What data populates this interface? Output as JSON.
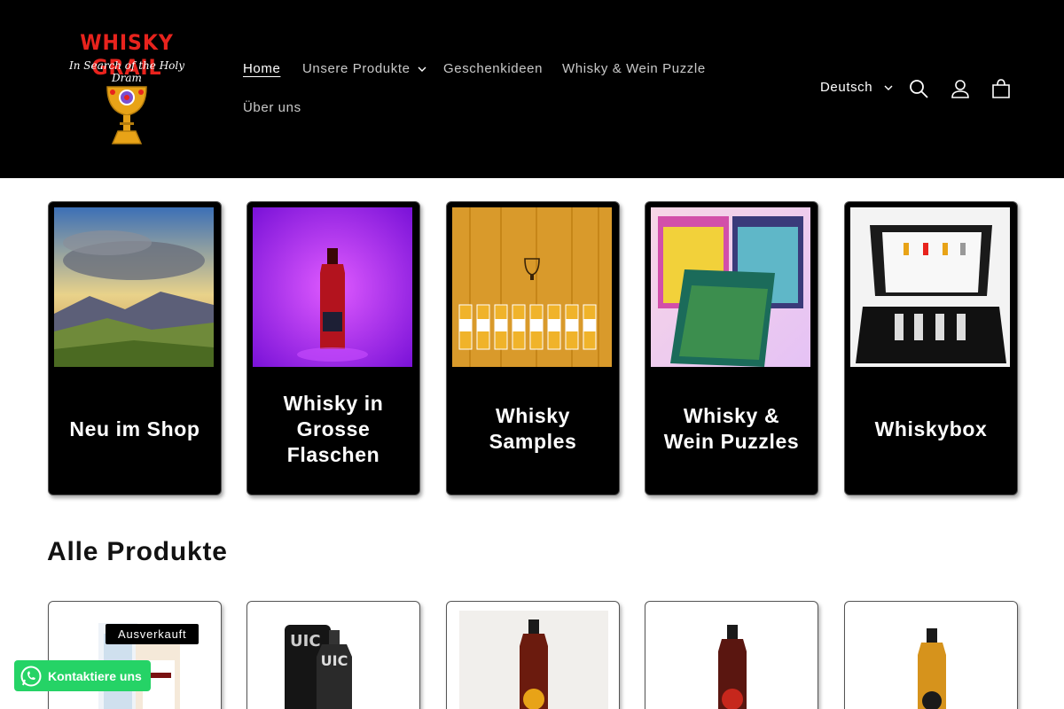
{
  "brand": {
    "name": "WHISKY GRAIL",
    "tagline": "In Search of the Holy Dram",
    "colors": {
      "logo_red": "#e8231d",
      "header_bg": "#000000",
      "whatsapp": "#25d366"
    }
  },
  "nav": {
    "items": [
      {
        "label": "Home",
        "active": true,
        "has_dropdown": false
      },
      {
        "label": "Unsere Produkte",
        "active": false,
        "has_dropdown": true
      },
      {
        "label": "Geschenkideen",
        "active": false,
        "has_dropdown": false
      },
      {
        "label": "Whisky & Wein Puzzle",
        "active": false,
        "has_dropdown": false
      },
      {
        "label": "Über uns",
        "active": false,
        "has_dropdown": false
      }
    ]
  },
  "header": {
    "language": "Deutsch",
    "icons": [
      "search-icon",
      "account-icon",
      "cart-icon"
    ]
  },
  "collections": [
    {
      "title": "Neu im Shop",
      "image": "mountain-sunrise"
    },
    {
      "title": "Whisky in Grosse Flaschen",
      "image": "bottle-purple"
    },
    {
      "title": "Whisky Samples",
      "image": "sample-bottles"
    },
    {
      "title": "Whisky & Wein Puzzles",
      "image": "puzzle-boxes"
    },
    {
      "title": "Whiskybox",
      "image": "gift-box"
    }
  ],
  "products_section": {
    "title": "Alle Produkte",
    "badge": "Ausverkauft"
  },
  "whatsapp": {
    "label": "Kontaktiere uns"
  }
}
